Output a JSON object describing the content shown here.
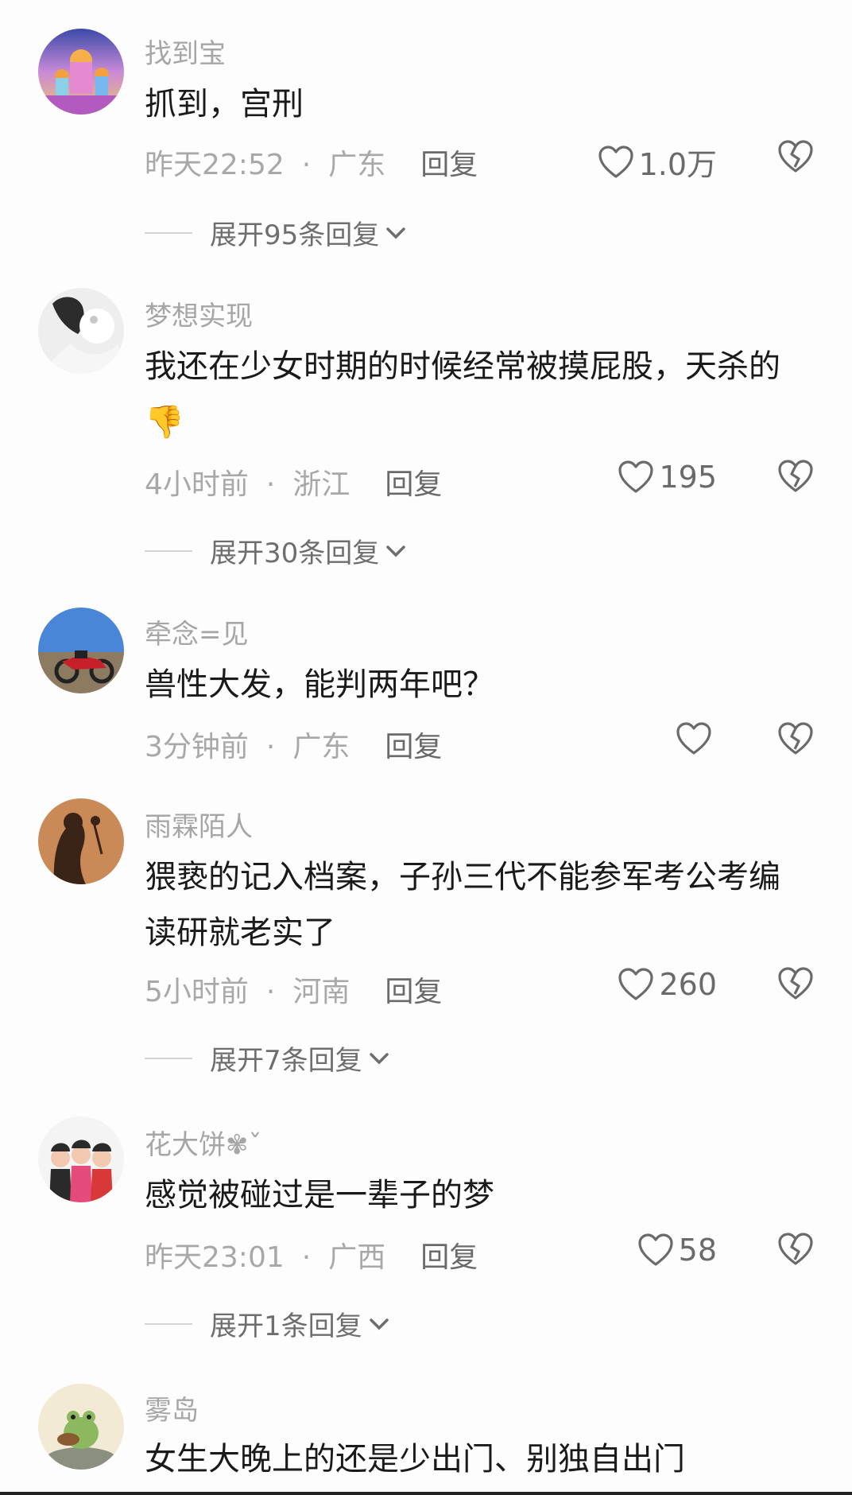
{
  "comments": [
    {
      "username": "找到宝",
      "text": "抓到，宫刑",
      "time": "昨天22:52",
      "location": "广东",
      "reply": "回复",
      "likes": "1.0万",
      "expand": "展开95条回复"
    },
    {
      "username": "梦想实现",
      "text": "我还在少女时期的时候经常被摸屁股，天杀的",
      "emoji": "👎",
      "time": "4小时前",
      "location": "浙江",
      "reply": "回复",
      "likes": "195",
      "expand": "展开30条回复"
    },
    {
      "username": "牵念=见",
      "text": "兽性大发，能判两年吧？",
      "time": "3分钟前",
      "location": "广东",
      "reply": "回复",
      "likes": ""
    },
    {
      "username": "雨霖陌人",
      "text": "猥亵的记入档案，子孙三代不能参军考公考编读研就老实了",
      "time": "5小时前",
      "location": "河南",
      "reply": "回复",
      "likes": "260",
      "expand": "展开7条回复"
    },
    {
      "username": "花大饼",
      "username_suffix": "✾ˇ",
      "text": "感觉被碰过是一辈子的梦",
      "time": "昨天23:01",
      "location": "广西",
      "reply": "回复",
      "likes": "58",
      "expand": "展开1条回复"
    },
    {
      "username": "雾岛",
      "text": "女生大晚上的还是少出门、别独自出门"
    }
  ],
  "icons": {
    "like": "heart-outline-icon",
    "dislike": "broken-heart-icon",
    "expand": "chevron-down-icon"
  }
}
